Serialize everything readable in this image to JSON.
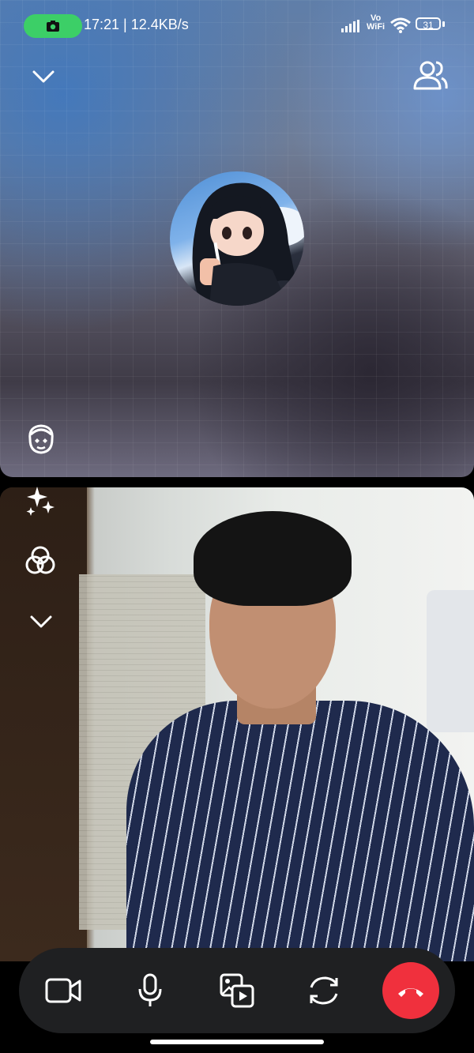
{
  "status_bar": {
    "time_speed": "17:21 | 12.4KB/s",
    "vowifi_top": "Vo",
    "vowifi_bottom": "WiFi",
    "battery": "31",
    "recording_color": "#3ccf67"
  },
  "top_bar": {
    "collapse_icon": "chevron-down-icon",
    "participants_icon": "people-icon"
  },
  "remote": {
    "avatar_desc": "anime-girl-avatar",
    "effects_icon": "face-hearts-icon"
  },
  "local": {
    "side_tools": [
      "sparkles-icon",
      "filters-icon",
      "chevron-down-icon"
    ]
  },
  "controls": {
    "items": [
      "video-camera-icon",
      "microphone-icon",
      "share-media-icon",
      "switch-camera-icon",
      "end-call-icon"
    ],
    "end_call_color": "#f0303d"
  }
}
